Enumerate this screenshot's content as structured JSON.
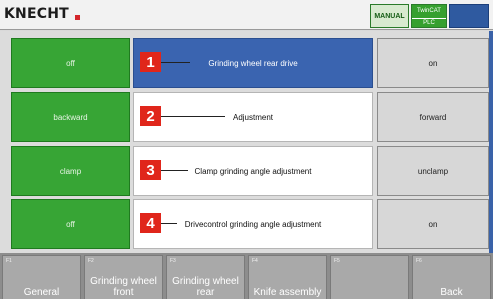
{
  "header": {
    "logo": "KNECHT",
    "mode_label": "MANUAL",
    "plc_line1": "TwinCAT",
    "plc_line2": "PLC"
  },
  "rows": [
    {
      "marker": "1",
      "left_label": "off",
      "center_label": "Grinding wheel rear drive",
      "right_label": "on",
      "active": true
    },
    {
      "marker": "2",
      "left_label": "backward",
      "center_label": "Adjustment",
      "right_label": "forward",
      "active": false
    },
    {
      "marker": "3",
      "left_label": "clamp",
      "center_label": "Clamp grinding angle adjustment",
      "right_label": "unclamp",
      "active": false
    },
    {
      "marker": "4",
      "left_label": "off",
      "center_label": "Drivecontrol grinding angle adjustment",
      "right_label": "on",
      "active": false
    }
  ],
  "function_keys": [
    {
      "key": "F1",
      "label": "General"
    },
    {
      "key": "F2",
      "label": "Grinding wheel front"
    },
    {
      "key": "F3",
      "label": "Grinding wheel rear"
    },
    {
      "key": "F4",
      "label": "Knife assembly"
    },
    {
      "key": "F5",
      "label": ""
    },
    {
      "key": "F6",
      "label": "Back"
    }
  ],
  "colors": {
    "action_green": "#37a535",
    "active_blue": "#3a64b0",
    "marker_red": "#e0261b",
    "fkey_grey": "#a9a9a9"
  }
}
